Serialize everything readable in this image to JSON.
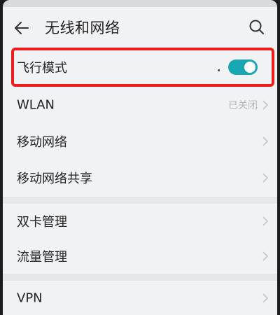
{
  "header": {
    "title": "无线和网络",
    "back_icon": "back-arrow-icon",
    "search_icon": "search-icon"
  },
  "colors": {
    "toggle_on": "#19a7b3",
    "highlight_border": "#ee1d1d",
    "background": "#f1f2f4"
  },
  "settings": {
    "airplane": {
      "label": "飞行模式",
      "enabled": true
    },
    "wlan": {
      "label": "WLAN",
      "value": "已关闭"
    },
    "mobile_network": {
      "label": "移动网络"
    },
    "hotspot": {
      "label": "移动网络共享"
    },
    "dual_sim": {
      "label": "双卡管理"
    },
    "data_usage": {
      "label": "流量管理"
    },
    "vpn": {
      "label": "VPN"
    }
  }
}
